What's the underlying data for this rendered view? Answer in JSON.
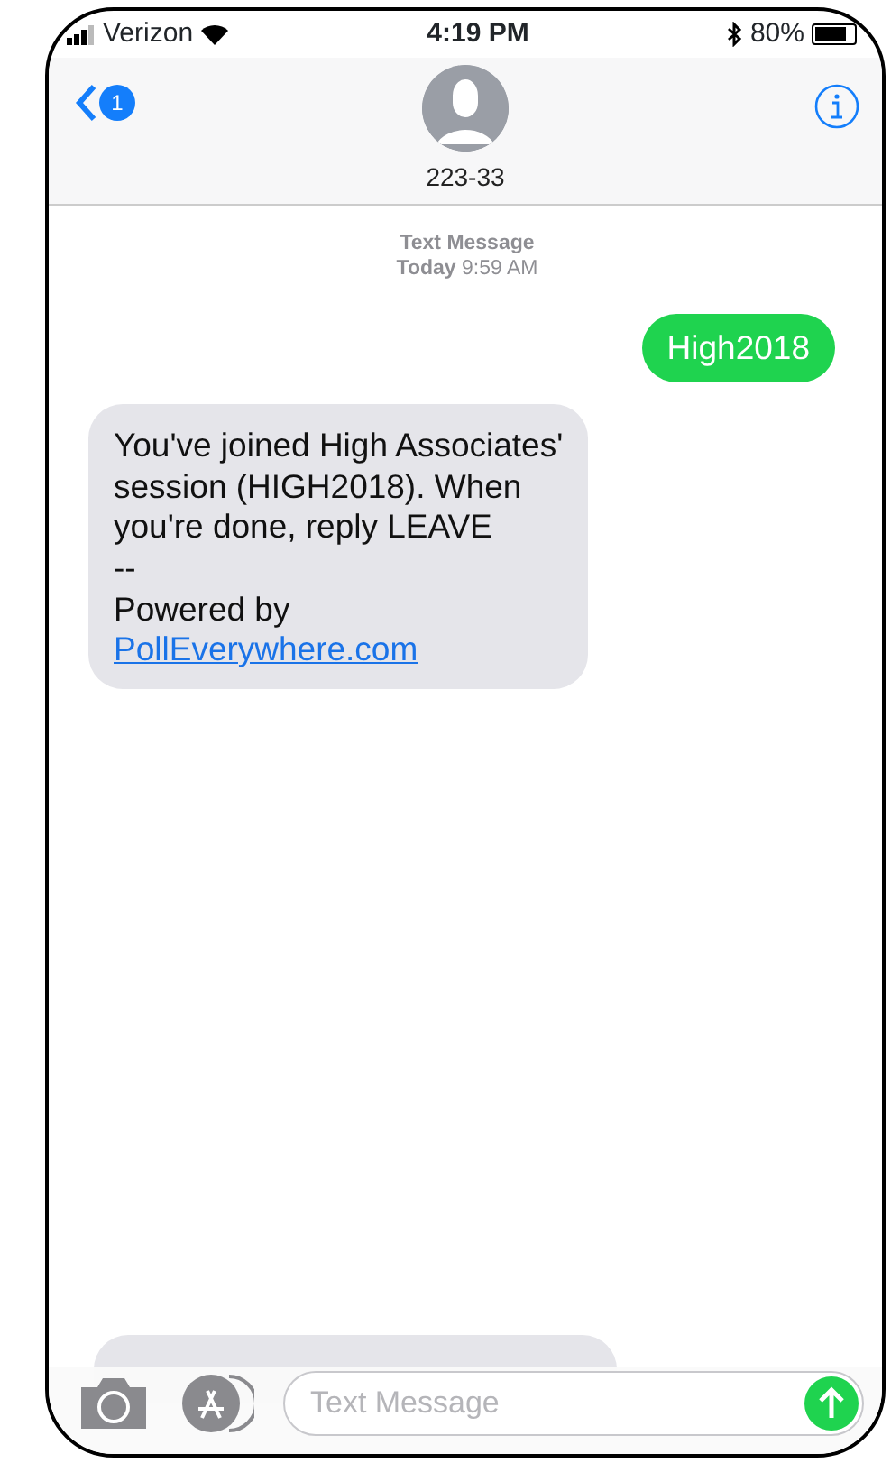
{
  "status_bar": {
    "carrier": "Verizon",
    "time": "4:19 PM",
    "battery_text": "80%",
    "battery": {
      "level": 0.8
    }
  },
  "header": {
    "back_badge": "1",
    "contact": "223-33"
  },
  "timestamp": {
    "label": "Text Message",
    "time": "**Today** 9:59 AM"
  },
  "messages": [
    {
      "kind": "sent",
      "lines": [
        "High2018"
      ]
    },
    {
      "kind": "received",
      "lines": [
        "You've joined High Associates'",
        "session (HIGH2018). When",
        "you're done, reply LEAVE",
        "--",
        "Powered by"
      ],
      "link": "PollEverywhere.com"
    },
    {
      "kind": "received-cut"
    }
  ],
  "composer": {
    "placeholder": "Text Message"
  }
}
